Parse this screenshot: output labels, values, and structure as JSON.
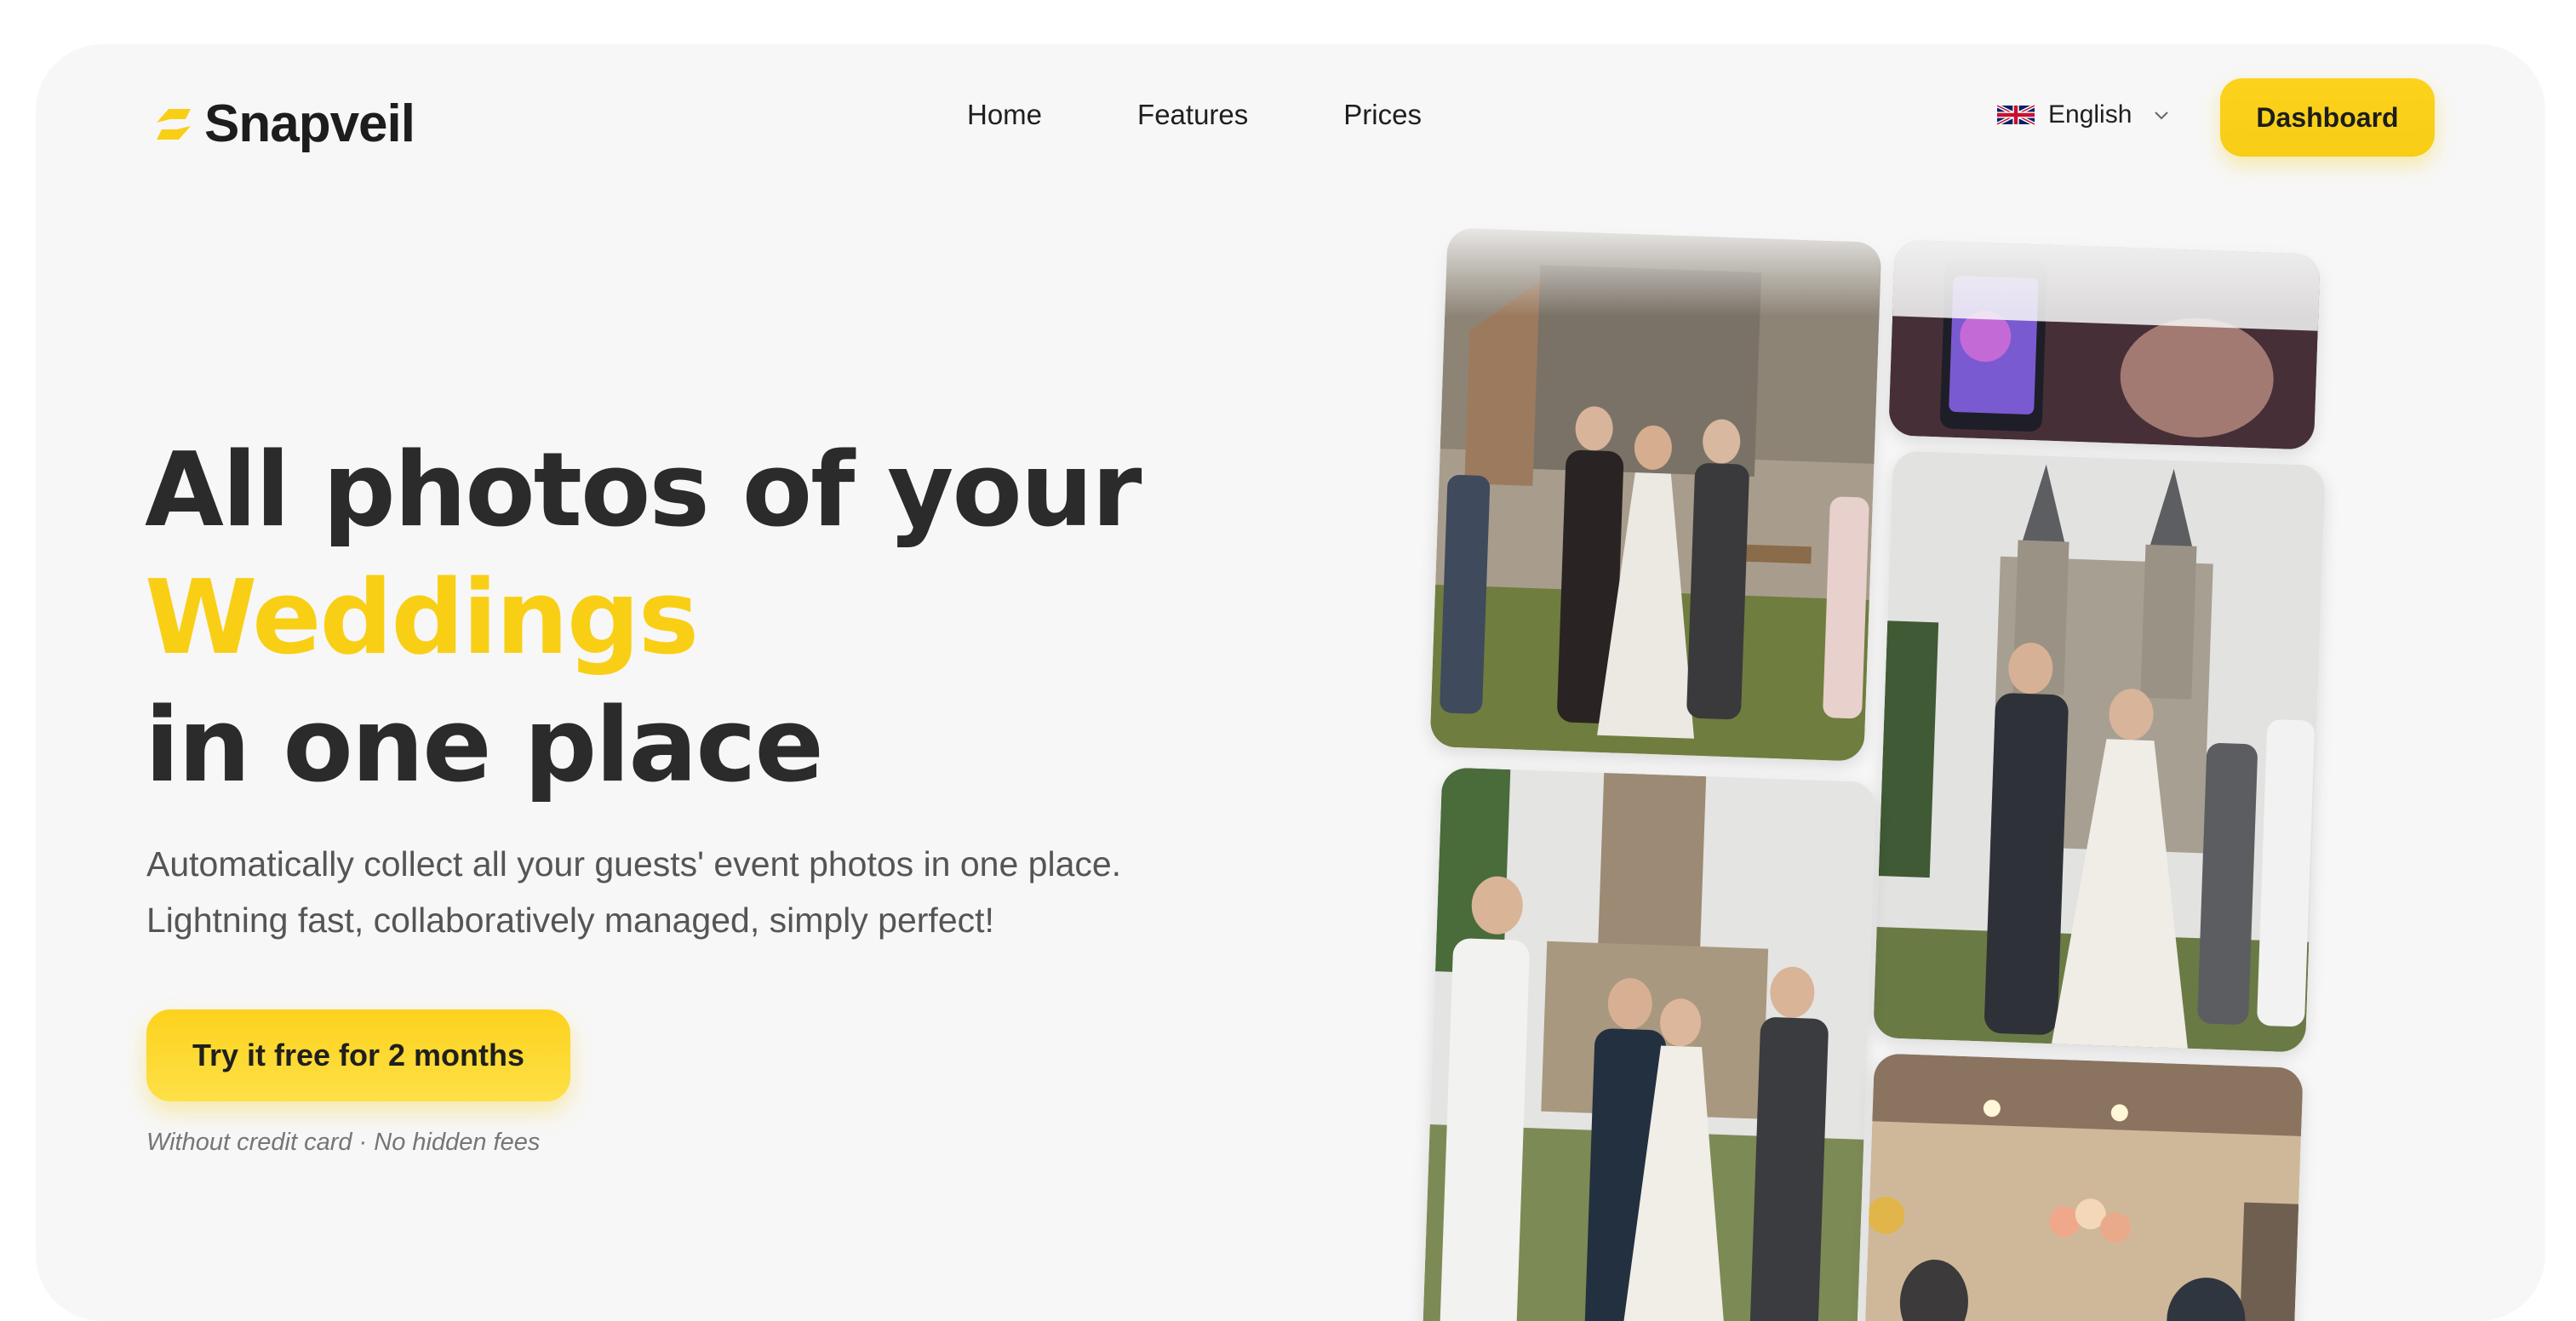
{
  "brand": {
    "name": "Snapveil",
    "logo_icon": "snapveil-logo-icon",
    "accent": "#f9cf16"
  },
  "nav": {
    "items": [
      "Home",
      "Features",
      "Prices"
    ]
  },
  "language": {
    "label": "English",
    "flag_icon": "uk-flag-icon"
  },
  "header": {
    "dashboard_label": "Dashboard"
  },
  "hero": {
    "line1": "All photos of your",
    "highlight": "Weddings",
    "line3": "in one place",
    "subtitle_line1": "Automatically collect all your guests' event photos in one place.",
    "subtitle_line2": "Lightning fast, collaboratively managed, simply perfect!",
    "cta_label": "Try it free for 2 months",
    "note": "Without credit card · No hidden fees"
  },
  "gallery": {
    "photos": [
      "wedding-group-photo",
      "phone-crowd-photo",
      "couple-cathedral-photo",
      "wedding-church-photo",
      "party-room-photo"
    ]
  }
}
